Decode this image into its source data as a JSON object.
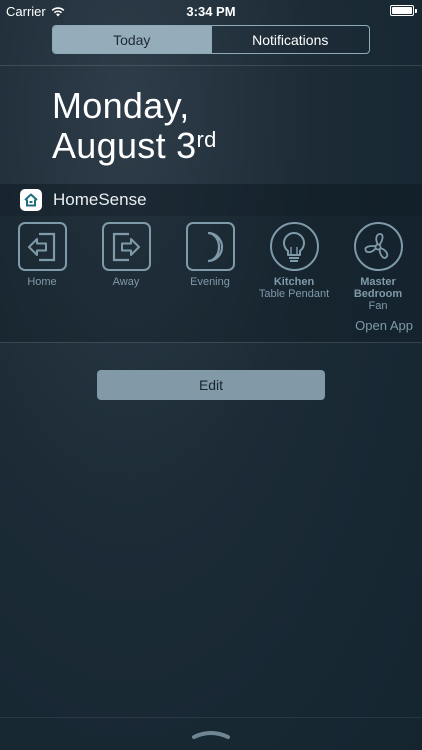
{
  "status_bar": {
    "carrier": "Carrier",
    "time": "3:34 PM"
  },
  "tabs": [
    {
      "label": "Today",
      "active": true
    },
    {
      "label": "Notifications",
      "active": false
    }
  ],
  "date": {
    "line1": "Monday,",
    "line2": "August 3",
    "suffix": "rd"
  },
  "widget": {
    "title": "HomeSense",
    "icon": "house-icon",
    "open_app_label": "Open App",
    "tiles": [
      {
        "label": "Home",
        "sublabel": "",
        "icon": "enter-icon"
      },
      {
        "label": "Away",
        "sublabel": "",
        "icon": "exit-icon"
      },
      {
        "label": "Evening",
        "sublabel": "",
        "icon": "moon-icon"
      },
      {
        "label": "Kitchen",
        "sublabel": "Table Pendant",
        "icon": "lightbulb-icon"
      },
      {
        "label": "Master Bedroom",
        "sublabel": "Fan",
        "icon": "fan-icon"
      }
    ]
  },
  "edit_label": "Edit",
  "colors": {
    "accent": "#7f9aa9",
    "active_segment": "#95acba",
    "edit_button": "#8299a7",
    "background": "#1c2b36"
  }
}
